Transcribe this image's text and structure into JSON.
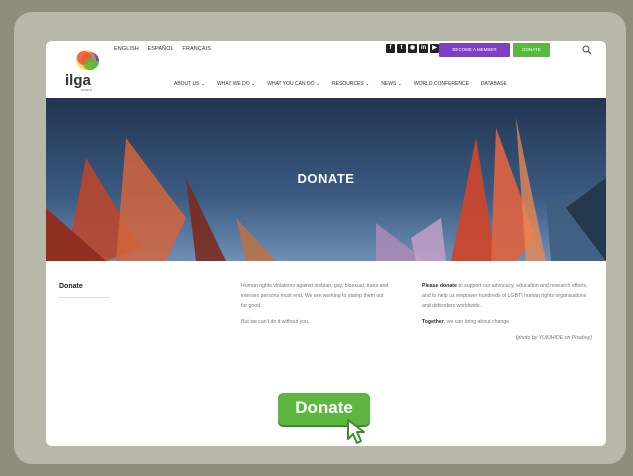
{
  "header": {
    "logo_text": "ilga",
    "logo_sub": "WORLD",
    "languages": [
      "ENGLISH",
      "ESPAÑOL",
      "FRANÇAIS"
    ],
    "social_icons": [
      "facebook-icon",
      "twitter-icon",
      "instagram-icon",
      "linkedin-icon",
      "youtube-icon"
    ],
    "member_button": "BECOME A MEMBER",
    "donate_button": "DONATE",
    "nav": [
      "ABOUT US ⌄",
      "WHAT WE DO ⌄",
      "WHAT YOU CAN DO ⌄",
      "RESOURCES ⌄",
      "NEWS ⌄",
      "WORLD CONFERENCE",
      "DATABASE"
    ]
  },
  "hero": {
    "title": "DONATE"
  },
  "sidebar": {
    "title": "Donate"
  },
  "column1": {
    "p1": "Human rights violations against lesbian, gay, bisexual, trans and intersex persons must end. We are working to stamp them out for good.",
    "p2": "But we can't do it without you."
  },
  "column2": {
    "p1_bold": "Please donate",
    "p1_rest": " to support our advocacy, education and research efforts, and to help us empower hundreds of LGBTI human rights organisations and defenders worldwide.",
    "p2_bold": "Together",
    "p2_rest": ", we can bring about change.",
    "credit": "(photo by YUKIHIDE on Pixabay)"
  },
  "cta": {
    "label": "Donate"
  },
  "colors": {
    "accent_green": "#58b840",
    "accent_purple": "#7e3fc1",
    "hero_blue": "#2f4a6e"
  }
}
